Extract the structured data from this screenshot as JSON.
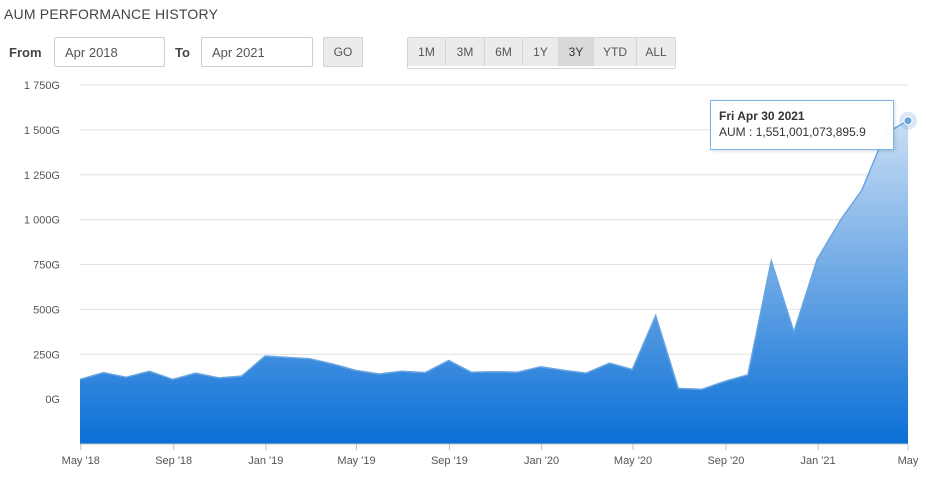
{
  "title": "AUM PERFORMANCE HISTORY",
  "controls": {
    "from_label": "From",
    "from_value": "Apr 2018",
    "to_label": "To",
    "to_value": "Apr 2021",
    "go_label": "GO",
    "ranges": [
      "1M",
      "3M",
      "6M",
      "1Y",
      "3Y",
      "YTD",
      "ALL"
    ],
    "active_range": "3Y"
  },
  "tooltip": {
    "date": "Fri Apr 30 2021",
    "series_label": "AUM",
    "value_text": "1,551,001,073,895.9"
  },
  "colors": {
    "area_top": "#c9def4",
    "area_bottom": "#0a6fd6",
    "line": "#6aa5e0",
    "grid": "#e0e0e0",
    "axis": "#c0c0c0"
  },
  "chart_data": {
    "type": "area",
    "title": "AUM PERFORMANCE HISTORY",
    "xlabel": "",
    "ylabel": "",
    "ylim": [
      -250,
      1750
    ],
    "yticks": [
      0,
      250,
      500,
      750,
      1000,
      1250,
      1500,
      1750
    ],
    "ytick_labels": [
      "0G",
      "250G",
      "500G",
      "750G",
      "1 000G",
      "1 250G",
      "1 500G",
      "1 750G"
    ],
    "x_domain": [
      "2018-04-30",
      "2021-04-30"
    ],
    "xticks": [
      "2018-05-01",
      "2018-09-01",
      "2019-01-01",
      "2019-05-01",
      "2019-09-01",
      "2020-01-01",
      "2020-05-01",
      "2020-09-01",
      "2021-01-01",
      "2021-05-01"
    ],
    "xtick_labels": [
      "May '18",
      "Sep '18",
      "Jan '19",
      "May '19",
      "Sep '19",
      "Jan '20",
      "May '20",
      "Sep '20",
      "Jan '21",
      "May"
    ],
    "grid": true,
    "legend": "none",
    "series": [
      {
        "name": "AUM",
        "unit": "G",
        "points": [
          [
            "2018-04-30",
            110
          ],
          [
            "2018-05-31",
            148
          ],
          [
            "2018-06-30",
            122
          ],
          [
            "2018-07-31",
            155
          ],
          [
            "2018-08-31",
            110
          ],
          [
            "2018-09-30",
            145
          ],
          [
            "2018-10-31",
            118
          ],
          [
            "2018-11-30",
            128
          ],
          [
            "2018-12-31",
            240
          ],
          [
            "2019-01-31",
            232
          ],
          [
            "2019-02-28",
            225
          ],
          [
            "2019-03-31",
            195
          ],
          [
            "2019-04-30",
            160
          ],
          [
            "2019-05-31",
            140
          ],
          [
            "2019-06-30",
            155
          ],
          [
            "2019-07-31",
            148
          ],
          [
            "2019-08-31",
            215
          ],
          [
            "2019-09-30",
            150
          ],
          [
            "2019-10-31",
            152
          ],
          [
            "2019-11-30",
            150
          ],
          [
            "2019-12-31",
            180
          ],
          [
            "2020-01-31",
            160
          ],
          [
            "2020-02-29",
            145
          ],
          [
            "2020-03-31",
            200
          ],
          [
            "2020-04-30",
            165
          ],
          [
            "2020-05-31",
            465
          ],
          [
            "2020-06-30",
            60
          ],
          [
            "2020-07-31",
            55
          ],
          [
            "2020-08-31",
            100
          ],
          [
            "2020-09-30",
            135
          ],
          [
            "2020-10-31",
            770
          ],
          [
            "2020-11-30",
            375
          ],
          [
            "2020-12-31",
            780
          ],
          [
            "2021-01-31",
            1000
          ],
          [
            "2021-02-28",
            1165
          ],
          [
            "2021-03-31",
            1480
          ],
          [
            "2021-04-30",
            1551
          ]
        ]
      }
    ]
  }
}
